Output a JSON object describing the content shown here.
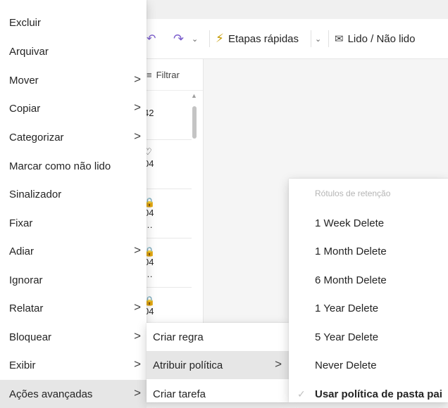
{
  "toolbar": {
    "etapas_label": "Etapas rápidas",
    "lido_label": "Lido / Não lido"
  },
  "list": {
    "filter_label": "Filtrar",
    "rows": [
      "42",
      "04",
      "04",
      "…",
      "04",
      "…",
      "04"
    ]
  },
  "context_menu": {
    "items": [
      {
        "label": "Excluir"
      },
      {
        "label": "Arquivar"
      },
      {
        "label": "Mover"
      },
      {
        "label": "Copiar"
      },
      {
        "label": "Categorizar"
      },
      {
        "label": "Marcar como não lido"
      },
      {
        "label": "Sinalizador"
      },
      {
        "label": "Fixar"
      },
      {
        "label": "Adiar"
      },
      {
        "label": "Ignorar"
      },
      {
        "label": "Relatar"
      },
      {
        "label": "Bloquear"
      },
      {
        "label": "Exibir"
      },
      {
        "label": "Ações avançadas"
      }
    ]
  },
  "advanced_submenu": {
    "items": [
      {
        "label": "Criar regra"
      },
      {
        "label": "Atribuir política"
      },
      {
        "label": "Criar tarefa"
      }
    ]
  },
  "policy_submenu": {
    "header": "Rótulos de retenção",
    "items": [
      {
        "label": "1 Week Delete"
      },
      {
        "label": "1 Month Delete"
      },
      {
        "label": "6 Month Delete"
      },
      {
        "label": "1 Year Delete"
      },
      {
        "label": "5 Year Delete"
      },
      {
        "label": "Never Delete"
      },
      {
        "label": "Usar política de pasta pai"
      }
    ]
  }
}
